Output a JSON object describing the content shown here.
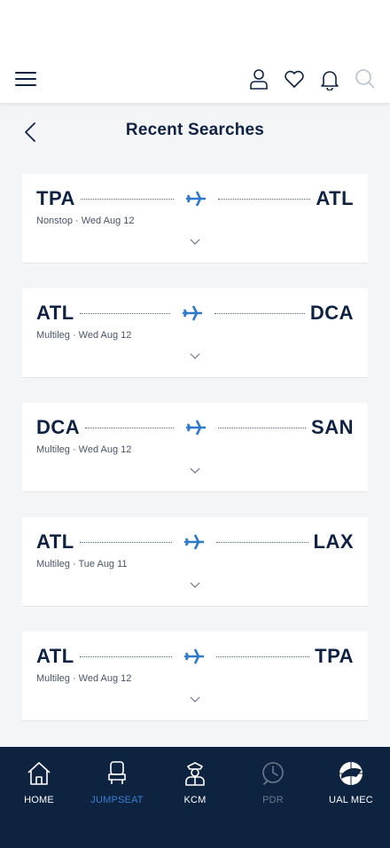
{
  "header": {
    "menu_icon": "hamburger-menu-icon",
    "icons": [
      "profile-icon",
      "heart-icon",
      "bell-icon",
      "search-icon"
    ]
  },
  "page": {
    "title": "Recent Searches",
    "back_icon": "chevron-left-icon"
  },
  "searches": [
    {
      "from": "TPA",
      "to": "ATL",
      "meta": "Nonstop · Wed Aug 12"
    },
    {
      "from": "ATL",
      "to": "DCA",
      "meta": "Multileg · Wed Aug 12"
    },
    {
      "from": "DCA",
      "to": "SAN",
      "meta": "Multileg · Wed Aug 12"
    },
    {
      "from": "ATL",
      "to": "LAX",
      "meta": "Multileg · Tue Aug 11"
    },
    {
      "from": "ATL",
      "to": "TPA",
      "meta": "Multileg · Wed Aug 12"
    }
  ],
  "bottom_nav": {
    "items": [
      {
        "label": "HOME",
        "icon": "home-icon"
      },
      {
        "label": "JUMPSEAT",
        "icon": "seat-icon",
        "state": "active"
      },
      {
        "label": "KCM",
        "icon": "pilot-icon"
      },
      {
        "label": "PDR",
        "icon": "clock-icon",
        "state": "disabled"
      },
      {
        "label": "UAL MEC",
        "icon": "alpa-globe-icon"
      }
    ]
  },
  "colors": {
    "navy": "#0f2242",
    "nav_bg": "#0e2340",
    "accent_blue": "#3a7dd1",
    "background": "#f4f5f7"
  }
}
